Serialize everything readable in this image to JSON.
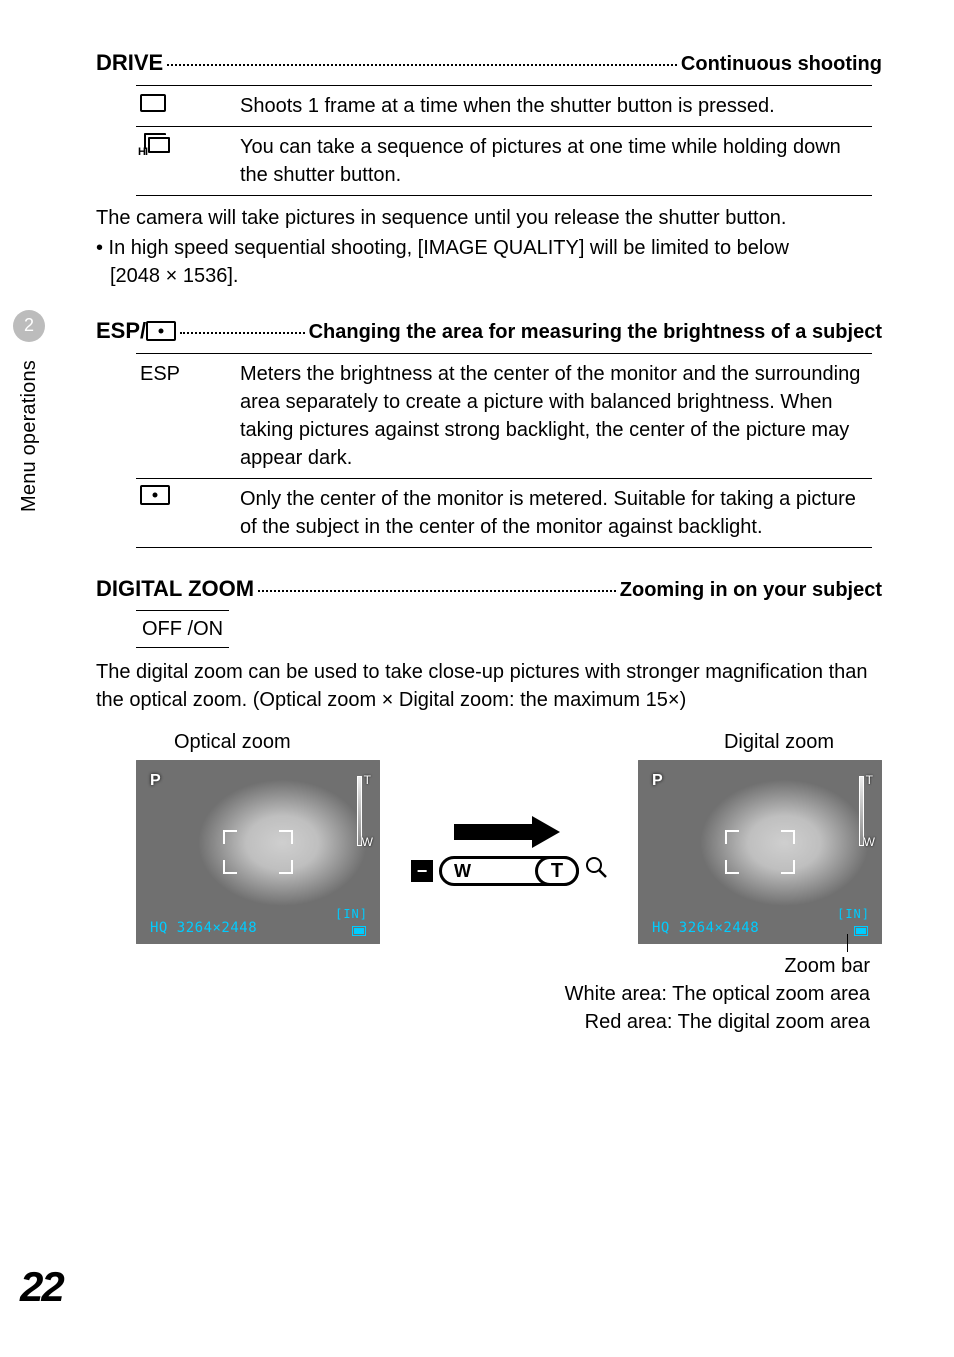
{
  "side": {
    "chapter": "2",
    "label": "Menu operations"
  },
  "drive": {
    "title_left": "DRIVE",
    "title_right": "Continuous shooting",
    "rows": [
      {
        "icon": "single-frame-icon",
        "text": "Shoots 1 frame at a time when the shutter button is pressed."
      },
      {
        "icon": "sequential-icon",
        "text": "You can take a sequence of pictures at one time while holding down the shutter button."
      }
    ],
    "note1": "The camera will take pictures in sequence until you release the shutter button.",
    "note2_bullet": "• In high speed sequential shooting, [IMAGE QUALITY] will be limited to below",
    "note2_line2": "[2048 × 1536]."
  },
  "esp": {
    "title_left": "ESP/",
    "title_right": "Changing the area for measuring the brightness of a subject",
    "rows": [
      {
        "label": "ESP",
        "text": "Meters the brightness at the center of the monitor and the surrounding area separately to create a picture with balanced brightness. When taking pictures against strong backlight, the center of the picture may appear dark."
      },
      {
        "label": "spot-icon",
        "text": "Only the center of the monitor is metered. Suitable for taking a picture of the subject in the center of the monitor against backlight."
      }
    ]
  },
  "digitalzoom": {
    "title_left": "DIGITAL ZOOM",
    "title_right": "Zooming in on your subject",
    "offon": "OFF  /ON",
    "desc": "The digital zoom can be used to take close-up pictures with stronger magnification than the optical zoom. (Optical zoom × Digital zoom: the maximum 15×)",
    "label_optical": "Optical zoom",
    "label_digital": "Digital zoom",
    "overlay": {
      "p": "P",
      "t": "T",
      "w": "W",
      "in": "[IN]",
      "hq": "HQ 3264×2448"
    },
    "slider_w": "W",
    "slider_t": "T",
    "caption_title": "Zoom bar",
    "caption_white": "White area: The optical zoom area",
    "caption_red": "Red area: The digital zoom area"
  },
  "page_number": "22"
}
